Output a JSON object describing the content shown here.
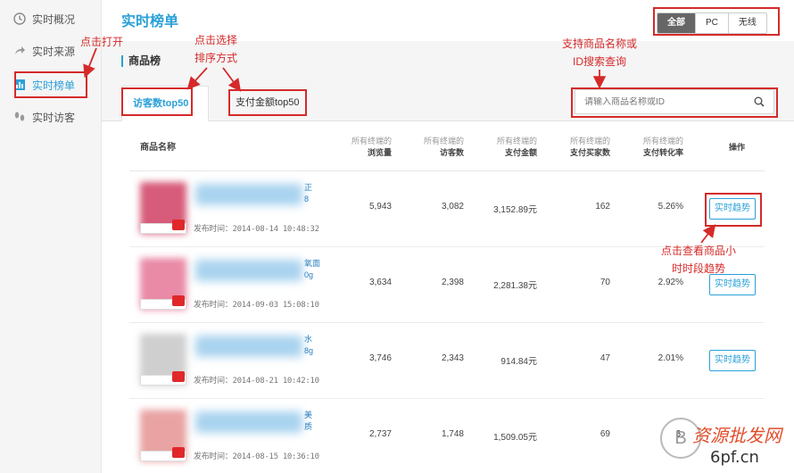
{
  "sidebar": {
    "items": [
      {
        "label": "实时概况",
        "icon": "clock-icon"
      },
      {
        "label": "实时来源",
        "icon": "share-arrow-icon"
      },
      {
        "label": "实时榜单",
        "icon": "bar-chart-icon"
      },
      {
        "label": "实时访客",
        "icon": "footprint-icon"
      }
    ]
  },
  "header": {
    "title": "实时榜单",
    "device_filter": [
      "全部",
      "PC",
      "无线"
    ],
    "device_selected": "全部"
  },
  "section": {
    "title": "商品榜"
  },
  "tabs": [
    {
      "label": "访客数top50",
      "active": true
    },
    {
      "label": "支付金额top50",
      "active": false
    }
  ],
  "search": {
    "placeholder": "请输入商品名称或ID"
  },
  "table": {
    "name_header": "商品名称",
    "columns": [
      {
        "sub": "所有终端的",
        "main": "浏览量"
      },
      {
        "sub": "所有终端的",
        "main": "访客数"
      },
      {
        "sub": "所有终端的",
        "main": "支付金额"
      },
      {
        "sub": "所有终端的",
        "main": "支付买家数"
      },
      {
        "sub": "所有终端的",
        "main": "支付转化率"
      }
    ],
    "op_header": "操作",
    "pub_prefix": "发布时间：",
    "rows": [
      {
        "title_tail": "正\n8",
        "pub": "2014-08-14 10:48:32",
        "pv": "5,943",
        "uv": "3,082",
        "amount": "3,152.89元",
        "buyers": "162",
        "rate": "5.26%",
        "op": "实时趋势",
        "thumb_color": "#d75b7a"
      },
      {
        "title_tail": "氧面\n0g",
        "pub": "2014-09-03 15:08:10",
        "pv": "3,634",
        "uv": "2,398",
        "amount": "2,281.38元",
        "buyers": "70",
        "rate": "2.92%",
        "op": "实时趋势",
        "thumb_color": "#e98aa6"
      },
      {
        "title_tail": "水\n8g",
        "pub": "2014-08-21 10:42:10",
        "pv": "3,746",
        "uv": "2,343",
        "amount": "914.84元",
        "buyers": "47",
        "rate": "2.01%",
        "op": "实时趋势",
        "thumb_color": "#cfcfcf"
      },
      {
        "title_tail": "美\n质",
        "pub": "2014-08-15 10:36:10",
        "pv": "2,737",
        "uv": "1,748",
        "amount": "1,509.05元",
        "buyers": "69",
        "rate": "3.",
        "op": "",
        "thumb_color": "#e9a3a3"
      }
    ]
  },
  "annotations": {
    "open": "点击打开",
    "sort": [
      "点击选择",
      "排序方式"
    ],
    "search_hint": [
      "支持商品名称或",
      "ID搜索查询"
    ],
    "trend_hint": [
      "点击查看商品小",
      "时时段趋势"
    ],
    "color": "#d52a2a"
  },
  "watermark": {
    "brand": "资源批发网",
    "site": "6pf.cn",
    "logo_text": "B"
  },
  "colors": {
    "accent": "#2aa0d8",
    "annotation": "#d52a2a"
  }
}
